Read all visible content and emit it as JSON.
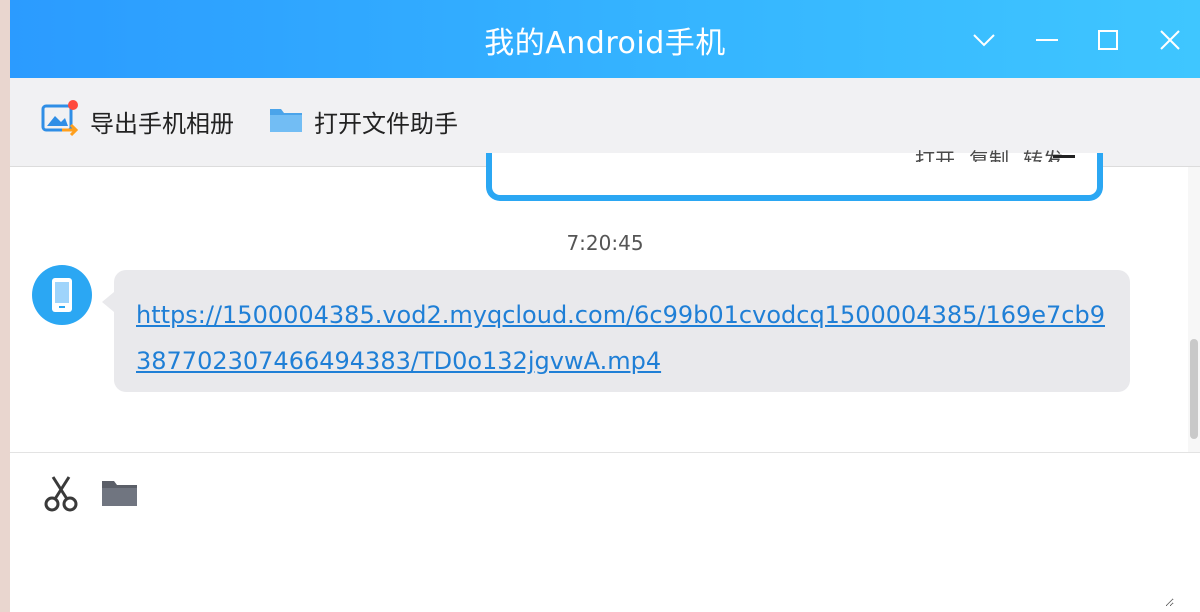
{
  "window": {
    "title": "我的Android手机",
    "controls": [
      "chevron-down-icon",
      "minimize-icon",
      "maximize-icon",
      "close-icon"
    ]
  },
  "toolbar": {
    "items": [
      {
        "label": "导出手机相册",
        "icon": "export-album-icon"
      },
      {
        "label": "打开文件助手",
        "icon": "folder-icon"
      }
    ]
  },
  "chat": {
    "card_partial_actions": [
      "打开",
      "复制",
      "转发"
    ],
    "messages": [
      {
        "timestamp": "7:20:45",
        "sender": "phone-avatar-icon",
        "text": "https://1500004385.vod2.myqcloud.com/6c99b01cvodcq1500004385/169e7cb9387702307466494383/TD0o132jgvwA.mp4"
      }
    ]
  },
  "input": {
    "tools": [
      "scissors-icon",
      "folder-icon"
    ],
    "value": ""
  },
  "colors": {
    "titlebar_start": "#2b9bff",
    "titlebar_end": "#3fc6ff",
    "accent": "#2ba7f3",
    "link": "#1f7fd6",
    "bubble": "#e9e9ec"
  }
}
